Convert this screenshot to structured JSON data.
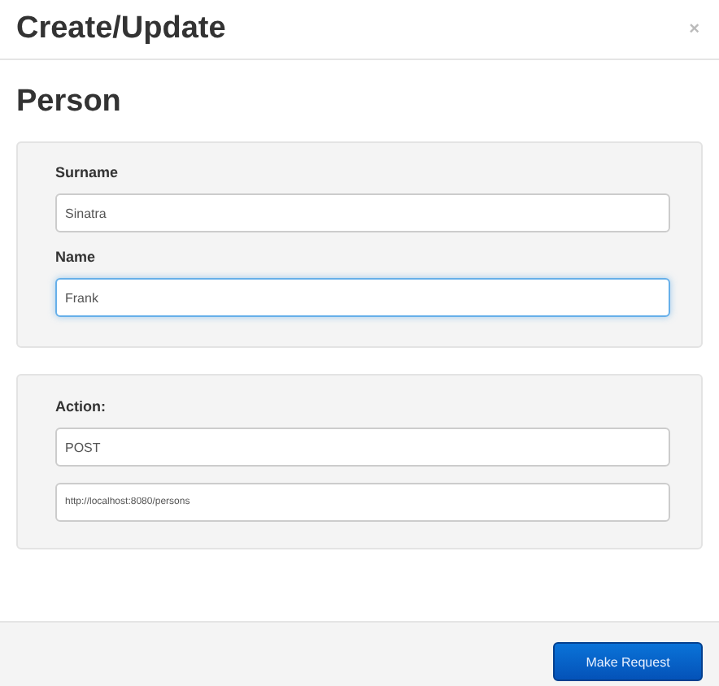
{
  "dialog": {
    "title": "Create/Update",
    "close": "×"
  },
  "heading": "Person",
  "person_fields": [
    {
      "label": "Surname",
      "value": "Sinatra",
      "focused": false
    },
    {
      "label": "Name",
      "value": "Frank",
      "focused": true
    }
  ],
  "request": {
    "label": "Action:",
    "method": "POST",
    "url": "http://localhost:8080/persons"
  },
  "footer": {
    "button": "Make Request"
  }
}
